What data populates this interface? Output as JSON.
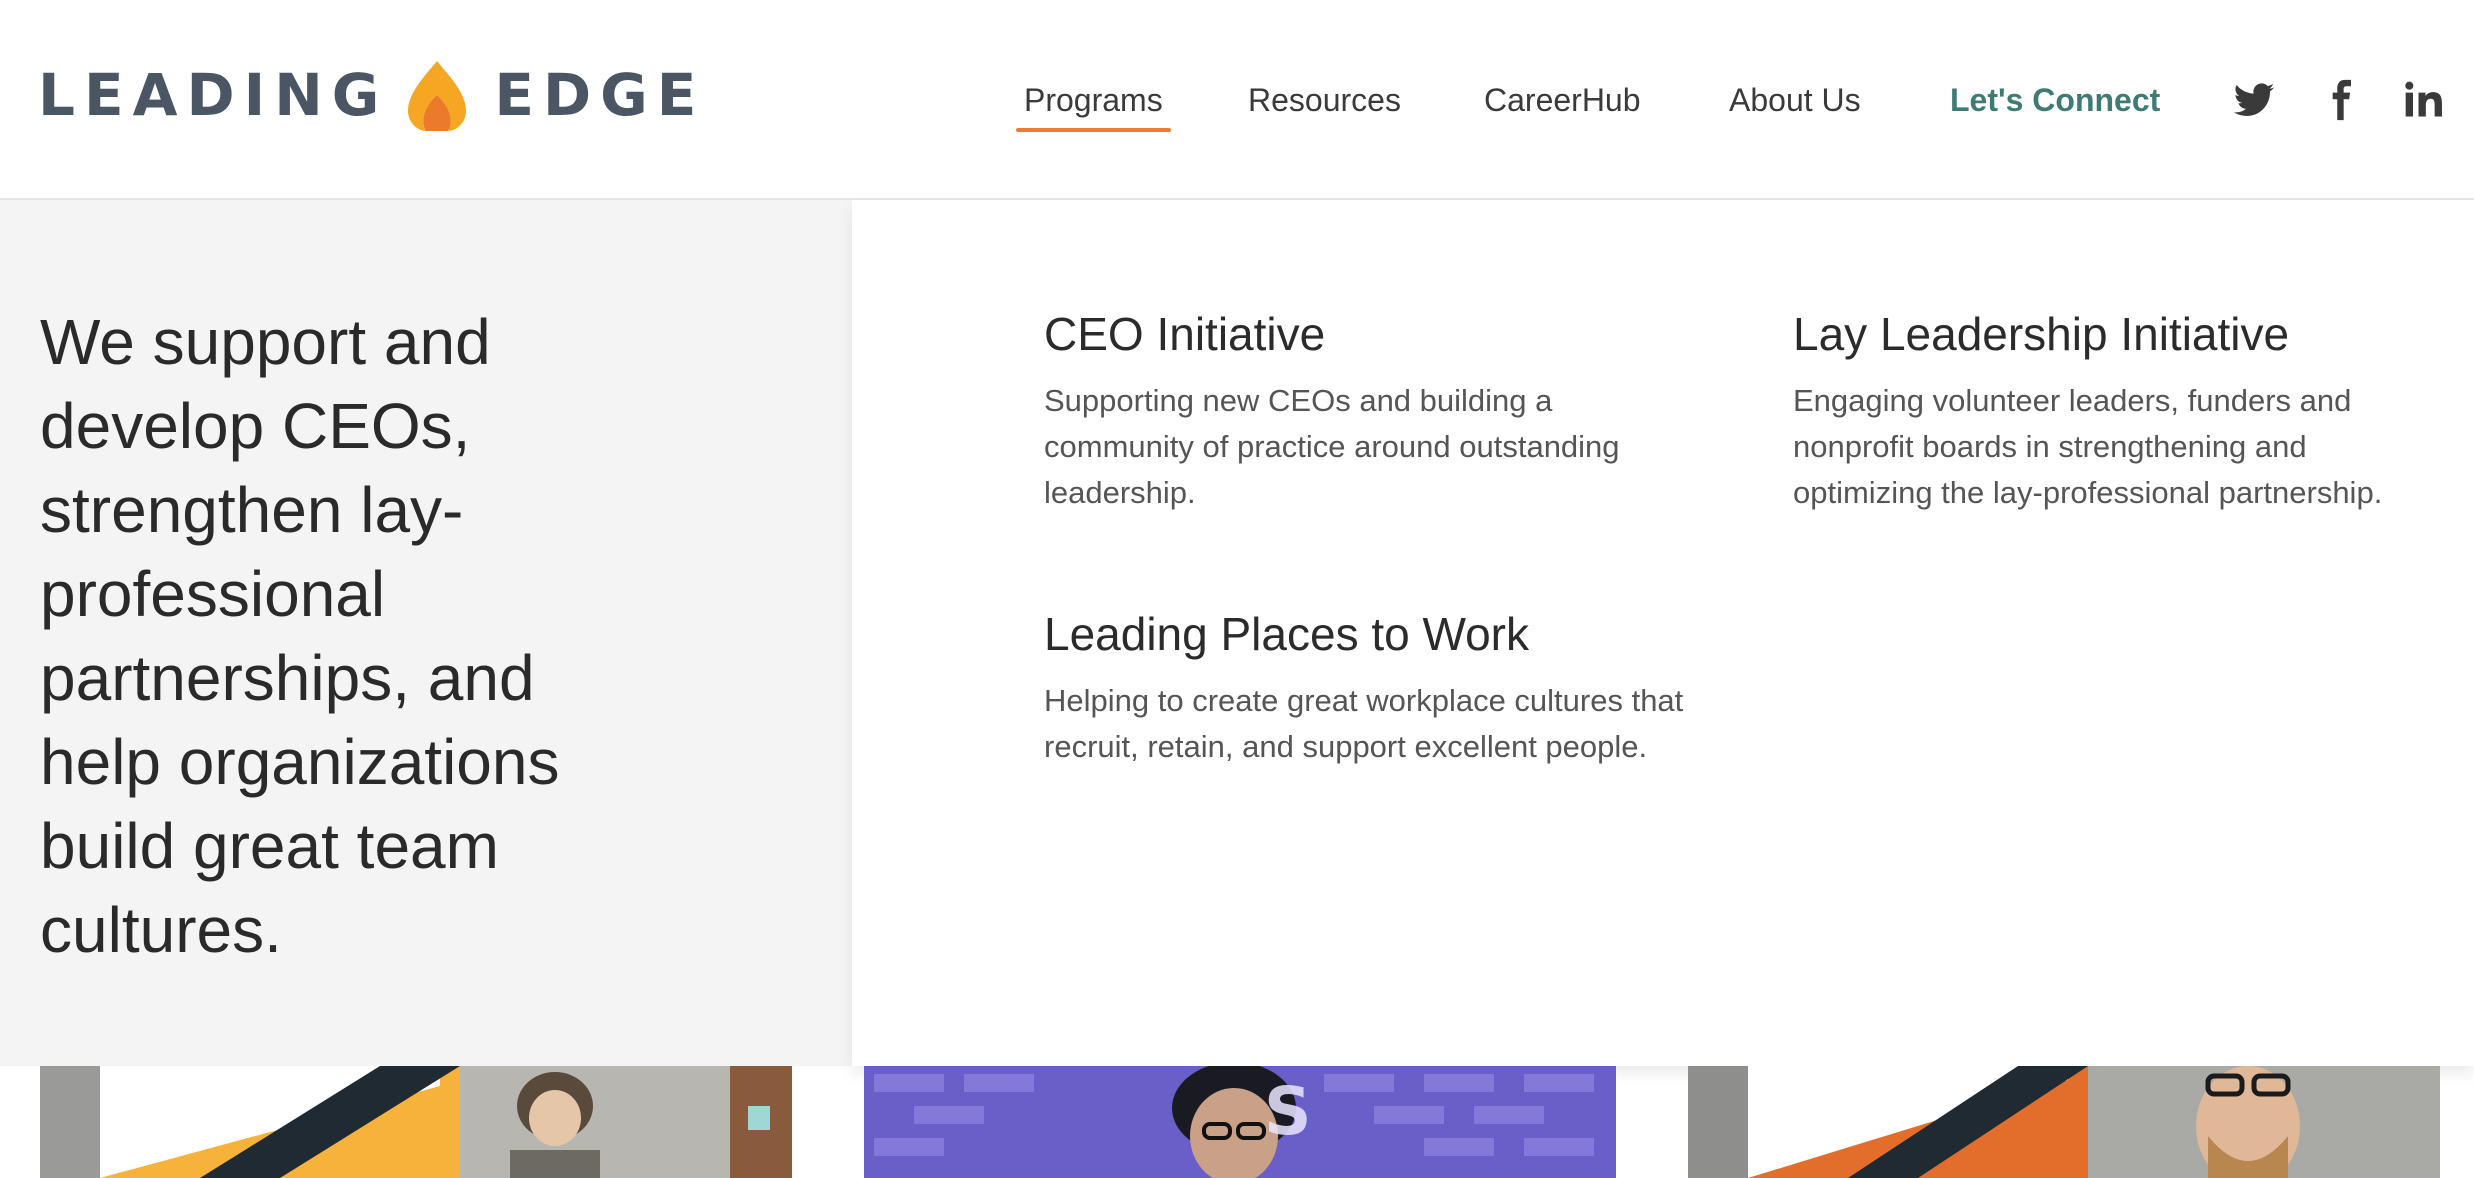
{
  "brand": {
    "word_left": "LEADING",
    "word_right": "EDGE",
    "flame_icon": "flame-logo-icon",
    "colors": {
      "logo_text": "#4a5664",
      "flame_light": "#f5a623",
      "flame_dark": "#ec7a2b"
    }
  },
  "nav": {
    "items": [
      {
        "label": "Programs",
        "active": true
      },
      {
        "label": "Resources"
      },
      {
        "label": "CareerHub"
      },
      {
        "label": "About Us"
      }
    ],
    "connect_label": "Let's Connect",
    "social_icons": [
      "twitter-icon",
      "facebook-icon",
      "linkedin-icon"
    ]
  },
  "menu": {
    "tagline": "We support and develop CEOs, strengthen lay-professional partnerships, and help organizations build great team cultures.",
    "programs": [
      {
        "title": "CEO Initiative",
        "description": "Supporting new CEOs and building a community of practice around outstanding leadership."
      },
      {
        "title": "Lay Leadership Initiative",
        "description": "Engaging volunteer leaders, funders and nonprofit boards in strengthening and optimizing the lay-professional partnership."
      },
      {
        "title": "Leading Places to Work",
        "description": "Helping to create great workplace cultures that recruit, retain, and support excellent people."
      }
    ]
  },
  "colors": {
    "accent_orange": "#ee7b2e",
    "connect_teal": "#3e7b75",
    "panel_gray": "#f4f4f4"
  }
}
